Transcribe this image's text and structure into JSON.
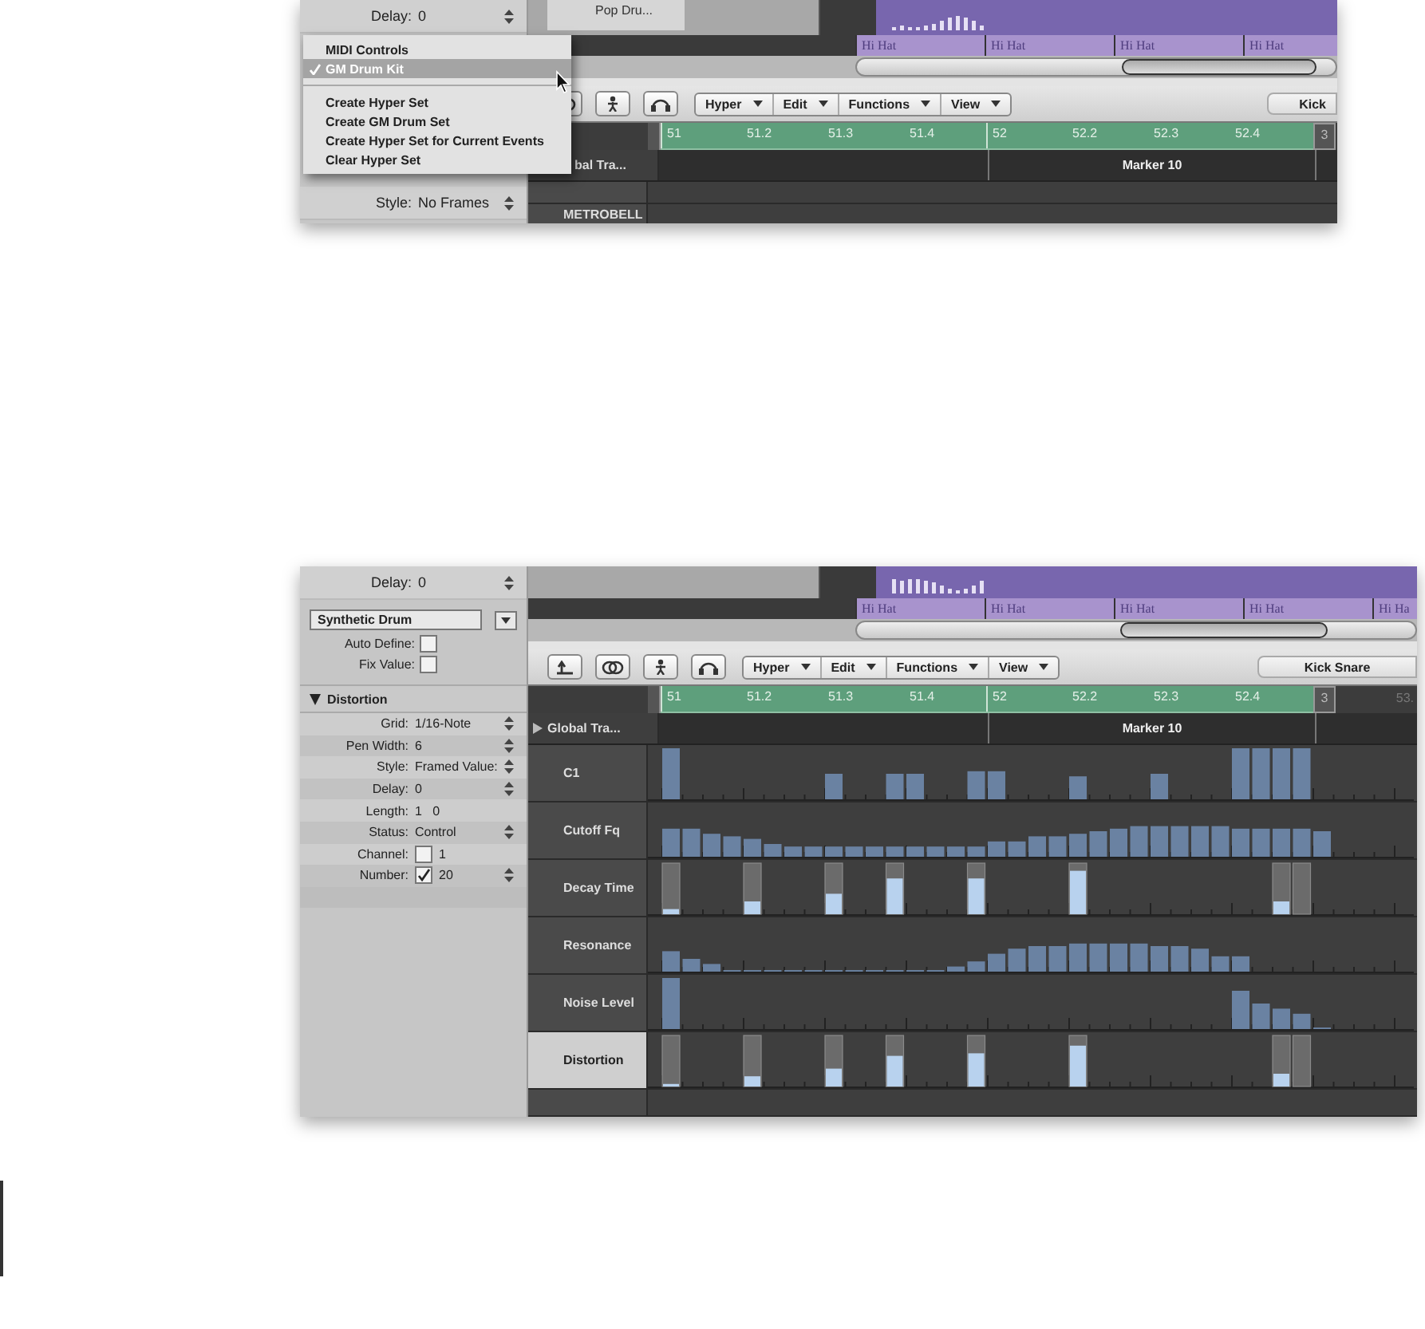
{
  "top_view": {
    "inspector": [
      {
        "label": "Delay:",
        "value": "0",
        "kind": "stepper"
      },
      {
        "label": "Style:",
        "value": "No Frames",
        "kind": "stepper"
      }
    ],
    "track_name": "Pop Dru...",
    "regions": [
      "Hi Hat",
      "Hi Hat",
      "Hi Hat",
      "Hi Hat"
    ],
    "toolbar_menus": [
      "Hyper",
      "Edit",
      "Functions",
      "View"
    ],
    "hyper_set": "Kick",
    "ruler": [
      "51",
      "51.2",
      "51.3",
      "51.4",
      "52",
      "52.2",
      "52.3",
      "52.4"
    ],
    "locator": "3",
    "marker": "Marker 10",
    "lanes": [
      "bal Tra...",
      "METROBELL"
    ],
    "menu": [
      {
        "kind": "item",
        "label": "MIDI Controls",
        "checked": false,
        "selected": false
      },
      {
        "kind": "item",
        "label": "GM Drum Kit",
        "checked": true,
        "selected": true
      },
      {
        "kind": "separator"
      },
      {
        "kind": "item",
        "label": "Create Hyper Set",
        "checked": false,
        "selected": false
      },
      {
        "kind": "item",
        "label": "Create GM Drum Set",
        "checked": false,
        "selected": false
      },
      {
        "kind": "item",
        "label": "Create Hyper Set for Current Events",
        "checked": false,
        "selected": false
      },
      {
        "kind": "item",
        "label": "Clear Hyper Set",
        "checked": false,
        "selected": false
      }
    ]
  },
  "bottom_view": {
    "delay": {
      "label": "Delay:",
      "value": "0"
    },
    "preset": "Synthetic Drum",
    "options": [
      {
        "label": "Auto Define:",
        "checked": false
      },
      {
        "label": "Fix Value:",
        "checked": false
      }
    ],
    "section": {
      "title": "Distortion",
      "expanded": true
    },
    "params": [
      {
        "label": "Grid:",
        "value": "1/16-Note",
        "kind": "stepper"
      },
      {
        "label": "Pen Width:",
        "value": "6",
        "kind": "stepper"
      },
      {
        "label": "Style:",
        "value": "Framed Value:",
        "kind": "stepper"
      },
      {
        "label": "Delay:",
        "value": "0",
        "kind": "stepper"
      },
      {
        "label": "Length:",
        "value": "1   0",
        "kind": "plain"
      },
      {
        "label": "Status:",
        "value": "Control",
        "kind": "stepper"
      },
      {
        "label": "Channel:",
        "value": "1",
        "kind": "plain",
        "checked": false
      },
      {
        "label": "Number:",
        "value": "20",
        "kind": "stepper",
        "checked": true
      }
    ],
    "regions": [
      "Hi Hat",
      "Hi Hat",
      "Hi Hat",
      "Hi Hat",
      "Hi Ha"
    ],
    "toolbar_menus": [
      "Hyper",
      "Edit",
      "Functions",
      "View"
    ],
    "hyper_set": "Kick Snare",
    "ruler": [
      "51",
      "51.2",
      "51.3",
      "51.4",
      "52",
      "52.2",
      "52.3",
      "52.4"
    ],
    "locator": "3",
    "ruler_end": "53.",
    "marker": "Marker 10",
    "global_tracks": "Global Tra...",
    "lanes": [
      {
        "name": "C1",
        "kind": "bars",
        "selected": false
      },
      {
        "name": "Cutoff Fq",
        "kind": "bars",
        "selected": false
      },
      {
        "name": "Decay Time",
        "kind": "framed",
        "selected": false
      },
      {
        "name": "Resonance",
        "kind": "bars",
        "selected": false
      },
      {
        "name": "Noise Level",
        "kind": "bars",
        "selected": false
      },
      {
        "name": "Distortion",
        "kind": "framed",
        "selected": true
      }
    ]
  }
}
